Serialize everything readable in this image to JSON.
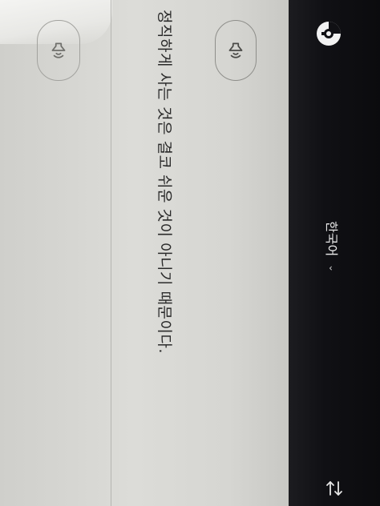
{
  "source": {
    "text": "정직하게 사는 것은 결코 쉬운 것이 아니기 때문이다."
  },
  "language": {
    "label": "한국어",
    "chevron": "⌄"
  },
  "icons": {
    "logo": "app-logo-icon",
    "speaker": "speaker-icon",
    "swap": "swap-arrows-icon"
  },
  "colors": {
    "page_bg": "#d6d6d2",
    "toolbar_bg": "#0f0f12",
    "text": "#2a2a2a",
    "toolbar_text": "#e8e8e8"
  }
}
